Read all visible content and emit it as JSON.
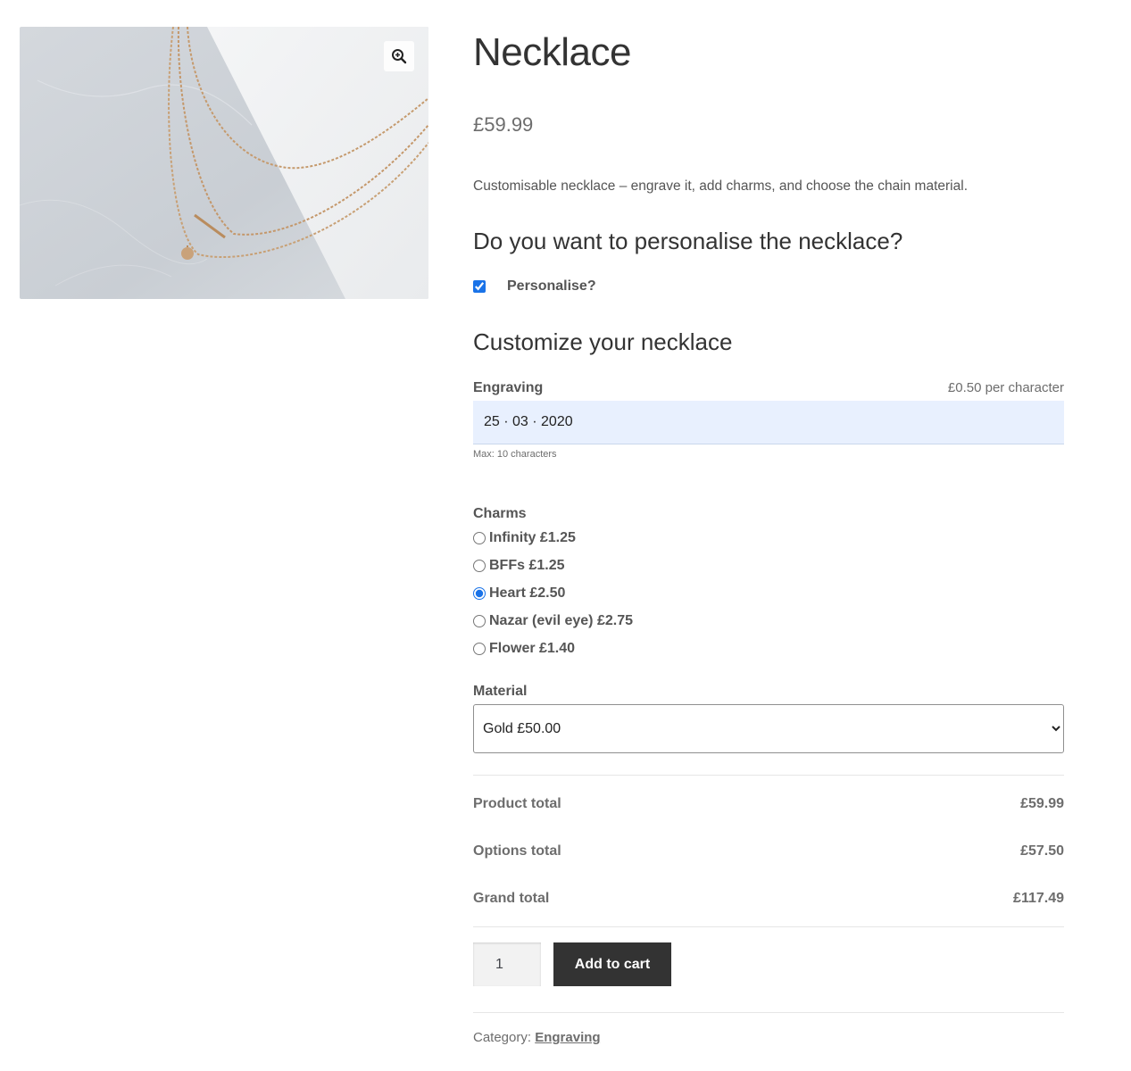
{
  "product": {
    "title": "Necklace",
    "price": "£59.99",
    "description": "Customisable necklace – engrave it, add charms, and choose the chain material.",
    "zoom_icon": "zoom-in-icon"
  },
  "personalise_section": {
    "heading": "Do you want to personalise the necklace?",
    "checkbox_label": "Personalise?",
    "checked": true
  },
  "customize_section": {
    "heading": "Customize your necklace",
    "engraving": {
      "label": "Engraving",
      "price_note": "£0.50 per character",
      "value": "25 · 03 · 2020",
      "max_note": "Max: 10 characters"
    },
    "charms": {
      "label": "Charms",
      "options": [
        {
          "label": "Infinity £1.25",
          "selected": false
        },
        {
          "label": "BFFs £1.25",
          "selected": false
        },
        {
          "label": "Heart £2.50",
          "selected": true
        },
        {
          "label": "Nazar (evil eye) £2.75",
          "selected": false
        },
        {
          "label": "Flower £1.40",
          "selected": false
        }
      ]
    },
    "material": {
      "label": "Material",
      "selected": "Gold £50.00"
    }
  },
  "totals": {
    "product_total_label": "Product total",
    "product_total": "£59.99",
    "options_total_label": "Options total",
    "options_total": "£57.50",
    "grand_total_label": "Grand total",
    "grand_total": "£117.49"
  },
  "cart": {
    "quantity": "1",
    "add_label": "Add to cart"
  },
  "meta": {
    "category_label": "Category:",
    "category_link": "Engraving"
  },
  "colors": {
    "button_bg": "#333333",
    "engraving_bg": "#e8f0fe",
    "accent": "#1a73e8"
  }
}
